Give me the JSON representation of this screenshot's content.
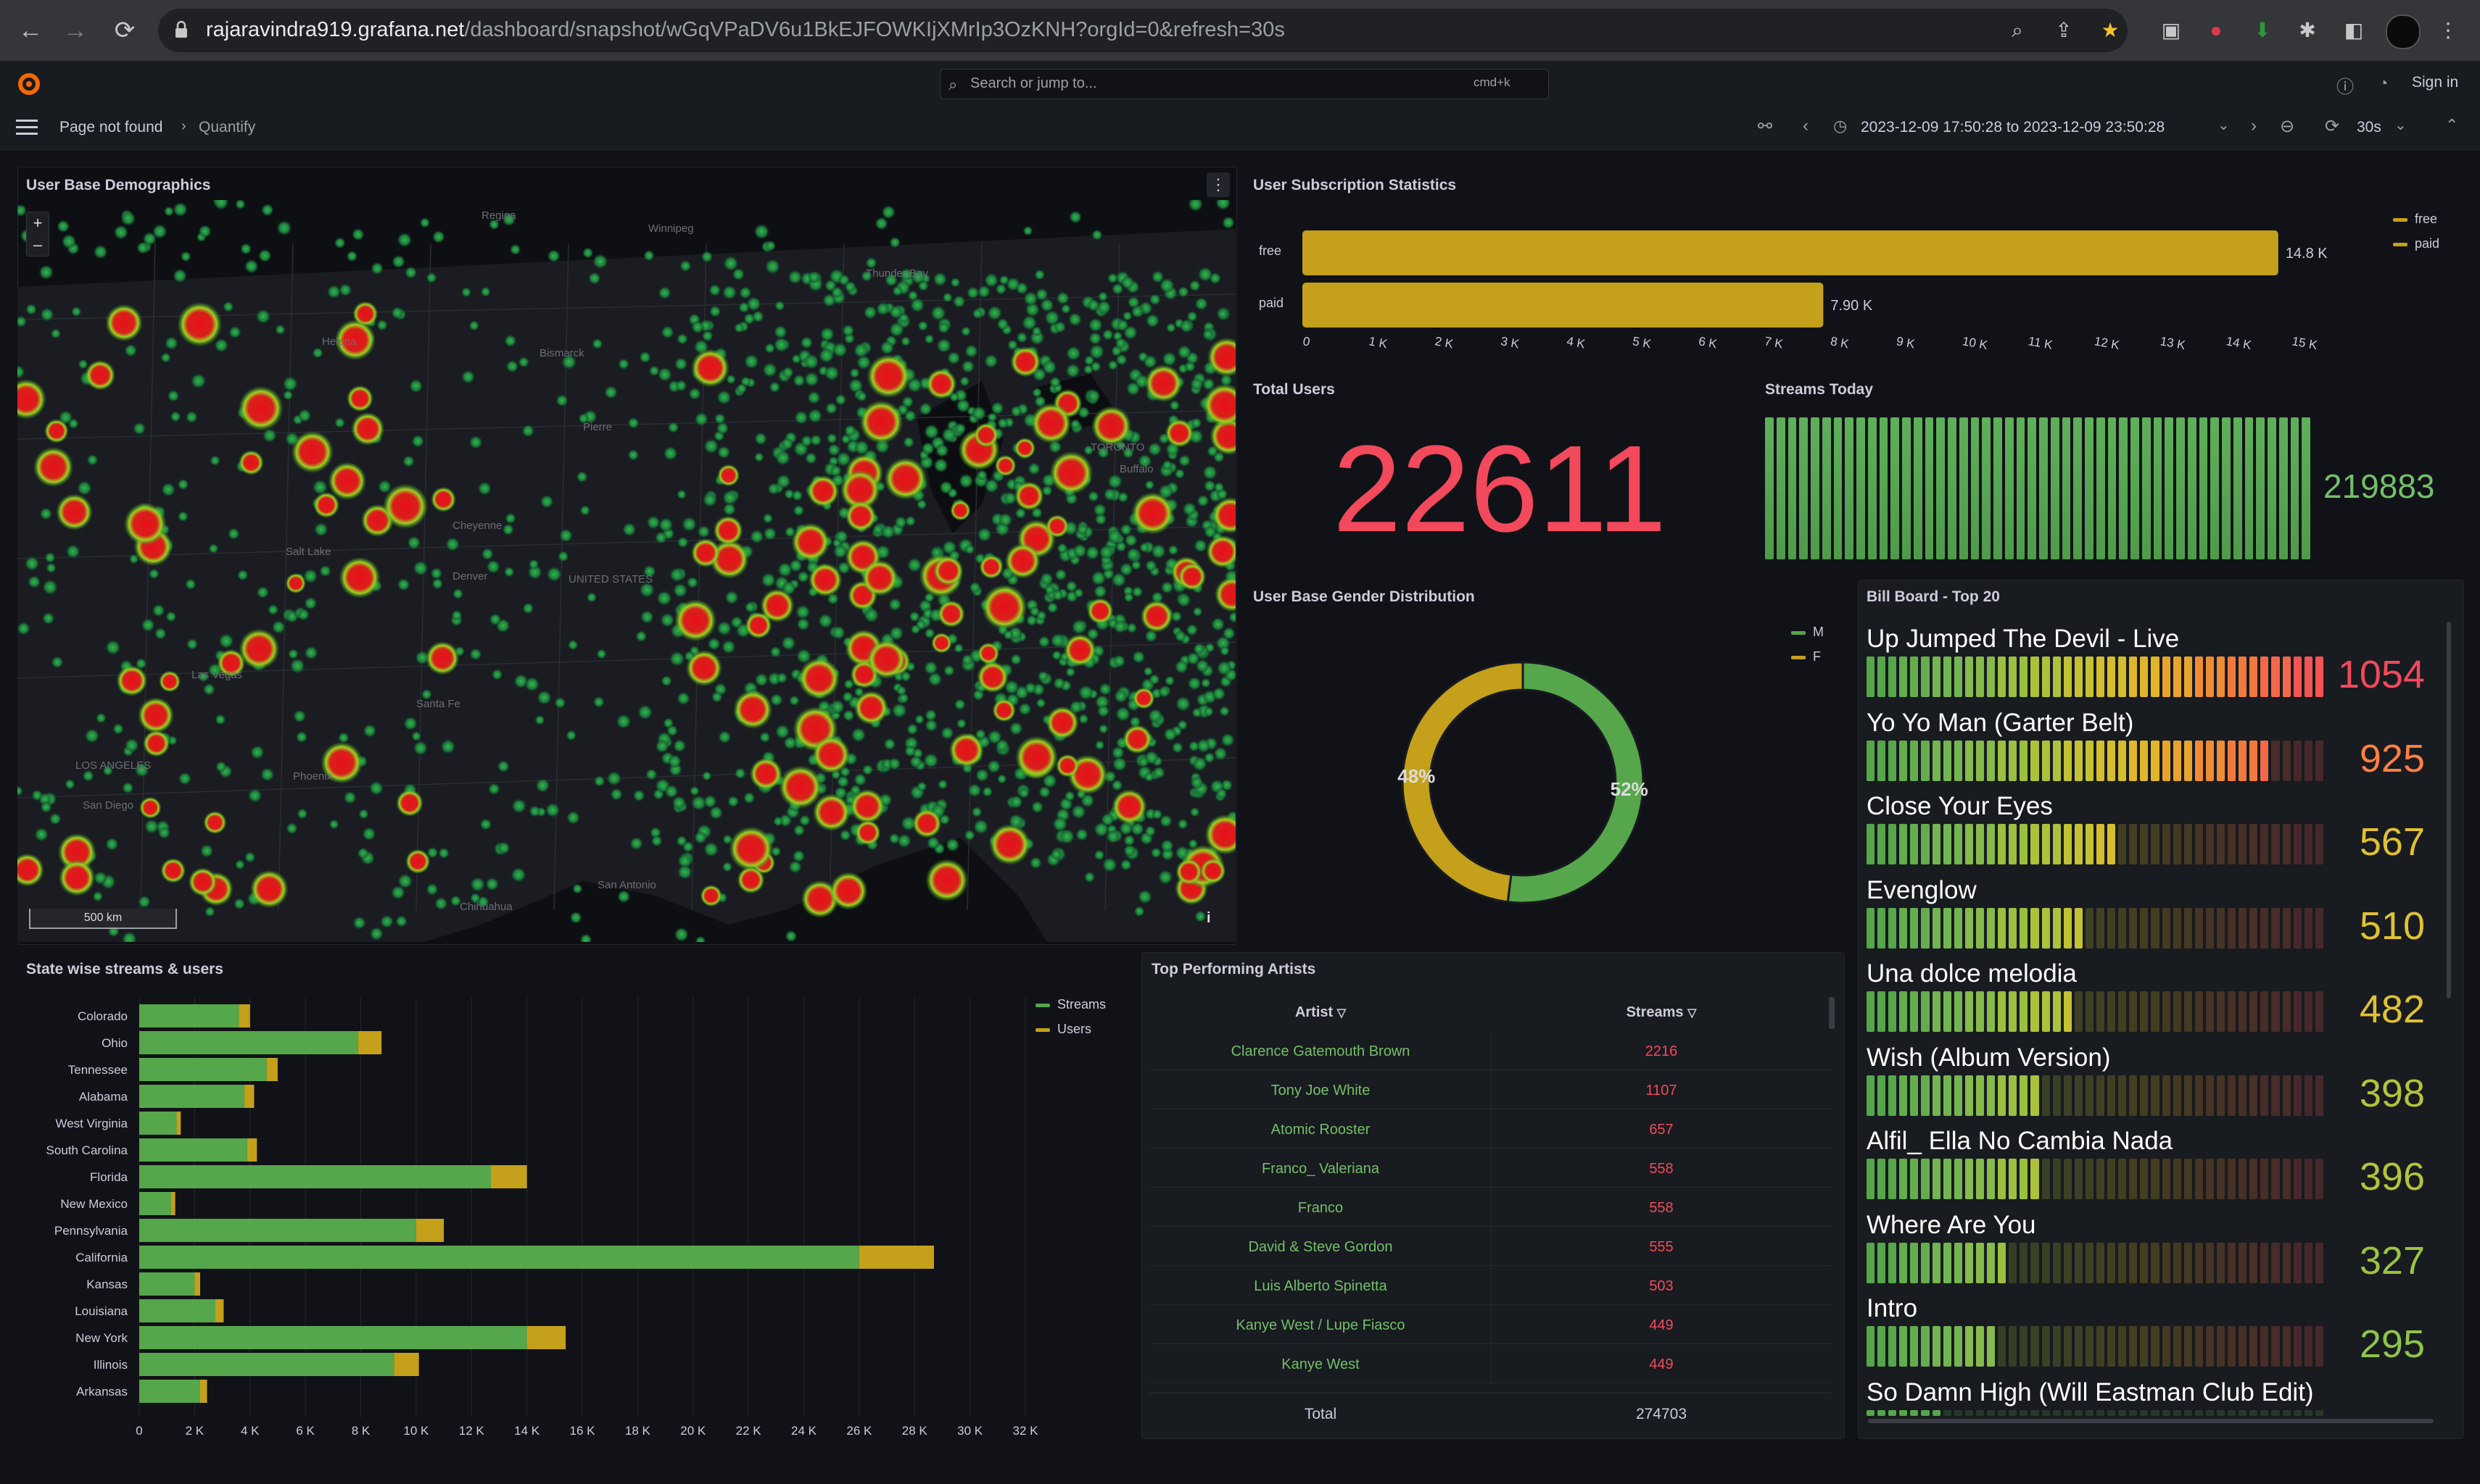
{
  "browser": {
    "url_host": "rajaravindra919.grafana.net",
    "url_path": "/dashboard/snapshot/wGqVPaDV6u1BkEJFOWKIjXMrIp3OzKNH?orgId=0&refresh=30s"
  },
  "topbar": {
    "search_placeholder": "Search or jump to...",
    "search_shortcut": "cmd+k",
    "sign_in": "Sign in"
  },
  "subbar": {
    "breadcrumb_1": "Page not found",
    "breadcrumb_2": "Quantify",
    "time_range": "2023-12-09 17:50:28 to 2023-12-09 23:50:28",
    "refresh": "30s"
  },
  "map_panel": {
    "title": "User Base Demographics",
    "zoom_in": "+",
    "zoom_out": "–",
    "scale": "500 km",
    "info": "i",
    "place_labels": [
      "Winnipeg",
      "Regina",
      "Thunder Bay",
      "Helena",
      "Bismarck",
      "Pierre",
      "Salt Lake",
      "Cheyenne",
      "Denver",
      "UNITED STATES",
      "Las Vegas",
      "Phoenix",
      "San Diego",
      "LOS ANGELES",
      "Santa Fe",
      "Chihuahua",
      "San Antonio",
      "TORONTO",
      "Buffalo"
    ]
  },
  "subscription_panel": {
    "title": "User Subscription Statistics",
    "legend": [
      {
        "label": "free",
        "color": "#c4a01b"
      },
      {
        "label": "paid",
        "color": "#c4a01b"
      }
    ],
    "bars": [
      {
        "label": "free",
        "value": 14800,
        "display": "14.8 K"
      },
      {
        "label": "paid",
        "value": 7900,
        "display": "7.90 K"
      }
    ],
    "ticks": [
      "0",
      "1 K",
      "2 K",
      "3 K",
      "4 K",
      "5 K",
      "6 K",
      "7 K",
      "8 K",
      "9 K",
      "10 K",
      "11 K",
      "12 K",
      "13 K",
      "14 K",
      "15 K"
    ]
  },
  "total_users": {
    "title": "Total Users",
    "value": "22611",
    "color": "#f2495c"
  },
  "streams_today": {
    "title": "Streams Today",
    "value": "219883",
    "color": "#73bf69"
  },
  "gender_panel": {
    "title": "User Base Gender Distribution",
    "legend": [
      {
        "label": "M",
        "color": "#56a64b"
      },
      {
        "label": "F",
        "color": "#c4a01b"
      }
    ],
    "slices": [
      {
        "label": "M",
        "percent": 52,
        "display": "52%"
      },
      {
        "label": "F",
        "percent": 48,
        "display": "48%"
      }
    ]
  },
  "billboard": {
    "title": "Bill Board - Top 20",
    "max": 1054,
    "items": [
      {
        "title": "Up Jumped The Devil - Live",
        "value": 1054,
        "display": "1054",
        "color": "#f2495c"
      },
      {
        "title": "Yo Yo Man (Garter Belt)",
        "value": 925,
        "display": "925",
        "color": "#ff7f43"
      },
      {
        "title": "Close Your Eyes",
        "value": 567,
        "display": "567",
        "color": "#e0c132"
      },
      {
        "title": "Evenglow",
        "value": 510,
        "display": "510",
        "color": "#e0c132"
      },
      {
        "title": "Una dolce melodia",
        "value": 482,
        "display": "482",
        "color": "#e0c132"
      },
      {
        "title": "Wish (Album Version)",
        "value": 398,
        "display": "398",
        "color": "#b3c43a"
      },
      {
        "title": "Alfil_ Ella No Cambia Nada",
        "value": 396,
        "display": "396",
        "color": "#b3c43a"
      },
      {
        "title": "Where Are You",
        "value": 327,
        "display": "327",
        "color": "#9ac43f"
      },
      {
        "title": "Intro",
        "value": 295,
        "display": "295",
        "color": "#8ec44a"
      },
      {
        "title": "So Damn High (Will Eastman Club Edit)",
        "value": null,
        "display": "",
        "color": "#73bf69"
      }
    ]
  },
  "state_panel": {
    "title": "State wise streams & users",
    "legend": [
      {
        "label": "Streams",
        "color": "#56a64b"
      },
      {
        "label": "Users",
        "color": "#c4a01b"
      }
    ],
    "ticks": [
      "0",
      "2 K",
      "4 K",
      "6 K",
      "8 K",
      "10 K",
      "12 K",
      "14 K",
      "16 K",
      "18 K",
      "20 K",
      "22 K",
      "24 K",
      "26 K",
      "28 K",
      "30 K",
      "32 K"
    ]
  },
  "chart_data": {
    "type": "bar",
    "orientation": "horizontal",
    "stacked": true,
    "categories": [
      "Colorado",
      "Ohio",
      "Tennessee",
      "Alabama",
      "West Virginia",
      "South Carolina",
      "Florida",
      "New Mexico",
      "Pennsylvania",
      "California",
      "Kansas",
      "Louisiana",
      "New York",
      "Illinois",
      "Arkansas"
    ],
    "series": [
      {
        "name": "Streams",
        "values": [
          3600,
          7900,
          4600,
          3800,
          1350,
          3900,
          12700,
          1150,
          10000,
          26000,
          2000,
          2750,
          14000,
          9200,
          2200
        ]
      },
      {
        "name": "Users",
        "values": [
          400,
          850,
          400,
          350,
          150,
          350,
          1300,
          150,
          1000,
          2700,
          200,
          300,
          1400,
          900,
          250
        ]
      }
    ],
    "xlim": [
      0,
      32000
    ],
    "grid": true,
    "legend_position": "top-right"
  },
  "artists_panel": {
    "title": "Top Performing Artists",
    "col_artist": "Artist",
    "col_streams": "Streams",
    "rows": [
      {
        "artist": "Clarence Gatemouth Brown",
        "streams": "2216"
      },
      {
        "artist": "Tony Joe White",
        "streams": "1107"
      },
      {
        "artist": "Atomic Rooster",
        "streams": "657"
      },
      {
        "artist": "Franco_ Valeriana",
        "streams": "558"
      },
      {
        "artist": "Franco",
        "streams": "558"
      },
      {
        "artist": "David & Steve Gordon",
        "streams": "555"
      },
      {
        "artist": "Luis Alberto Spinetta",
        "streams": "503"
      },
      {
        "artist": "Kanye West / Lupe Fiasco",
        "streams": "449"
      },
      {
        "artist": "Kanye West",
        "streams": "449"
      }
    ],
    "total_label": "Total",
    "total_value": "274703"
  }
}
